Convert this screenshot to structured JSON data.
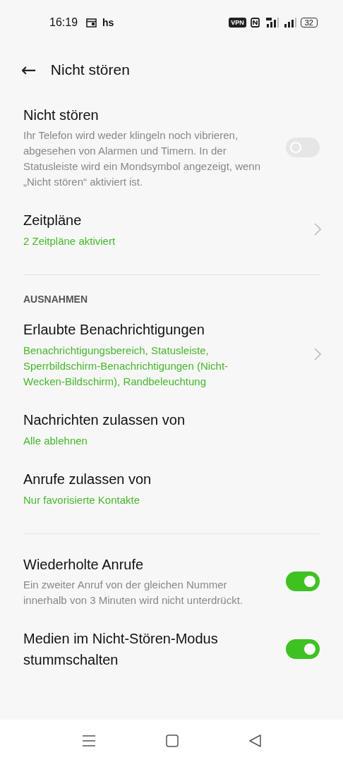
{
  "status_bar": {
    "time": "16:19",
    "carrier": "hs",
    "vpn": "VPN",
    "battery": "32"
  },
  "header": {
    "back": "←",
    "title": "Nicht stören"
  },
  "items": [
    {
      "kind": "toggle",
      "title": "Nicht stören",
      "description": "Ihr Telefon wird weder klingeln noch vibrieren, abgesehen von Alarmen und Timern. In der Statusleiste wird ein Mondsymbol angezeigt, wenn „Nicht stören“ aktiviert ist.",
      "on": false
    },
    {
      "kind": "link",
      "title": "Zeitpläne",
      "subtitle": "2 Zeitpläne aktiviert",
      "chevron": true
    },
    {
      "kind": "divider"
    },
    {
      "kind": "section",
      "title": "AUSNAHMEN"
    },
    {
      "kind": "link",
      "title": "Erlaubte Benachrichtigungen",
      "subtitle": "Benachrichtigungsbereich, Statusleiste, Sperrbildschirm-Benachrichtigungen (Nicht-Wecken-Bildschirm), Randbeleuchtung",
      "chevron": true
    },
    {
      "kind": "link",
      "title": "Nachrichten zulassen von",
      "subtitle": "Alle ablehnen",
      "chevron": false
    },
    {
      "kind": "link",
      "title": "Anrufe zulassen von",
      "subtitle": "Nur favorisierte Kontakte",
      "chevron": false
    },
    {
      "kind": "divider"
    },
    {
      "kind": "toggle",
      "title": "Wiederholte Anrufe",
      "description": "Ein zweiter Anruf von der gleichen Nummer innerhalb von 3 Minuten wird nicht unterdrückt.",
      "on": true
    },
    {
      "kind": "toggle",
      "title": "Medien im Nicht-Stören-Modus stummschalten",
      "on": true
    }
  ]
}
